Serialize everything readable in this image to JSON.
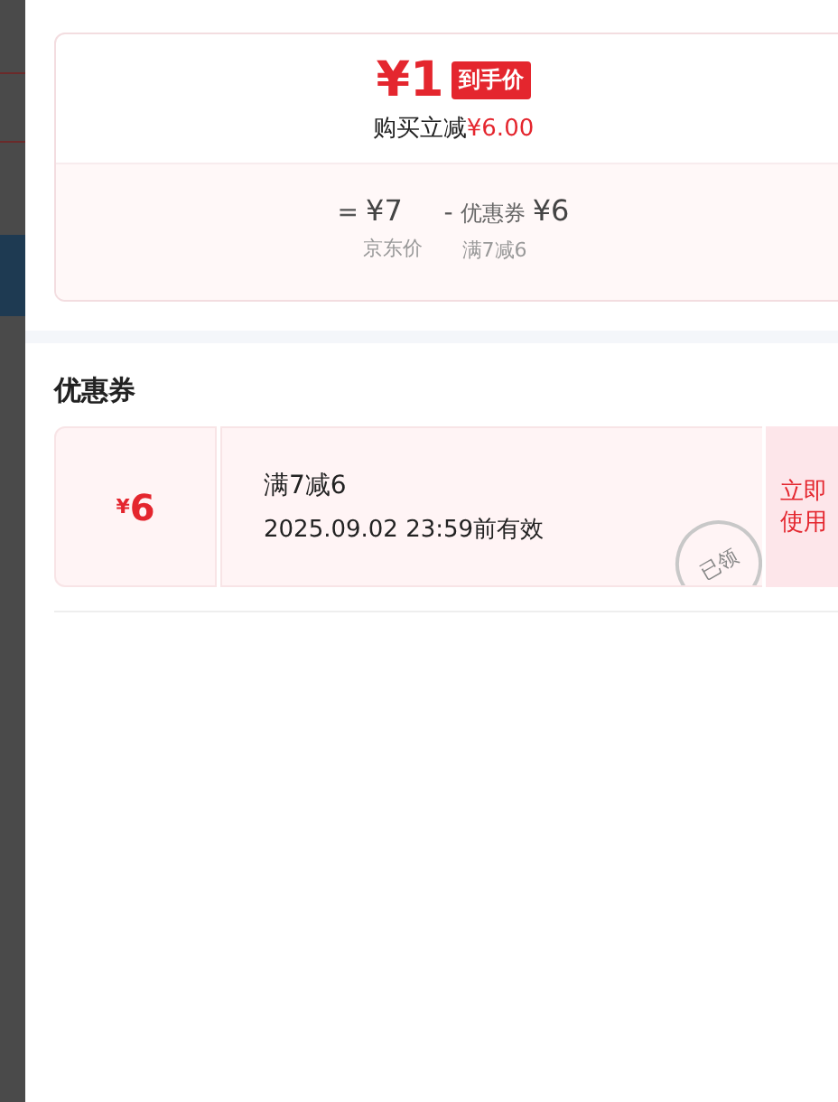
{
  "price_card": {
    "final_price": "¥1",
    "final_badge": "到手价",
    "saving_label": "购买立减",
    "saving_amount": "¥6.00",
    "breakdown": [
      {
        "kind": "base",
        "operator": "=",
        "amount": "¥7",
        "caption": "京东价"
      },
      {
        "kind": "discount",
        "operator": "-",
        "label": "优惠券",
        "amount": "¥6",
        "caption": "满7减6"
      }
    ]
  },
  "coupons_section": {
    "title": "优惠券",
    "coupons": [
      {
        "amount_symbol": "¥",
        "amount": "6",
        "name": "满7减6",
        "validity": "2025.09.02 23:59前有效",
        "stamp": "已领",
        "action": "立即使用"
      }
    ]
  }
}
